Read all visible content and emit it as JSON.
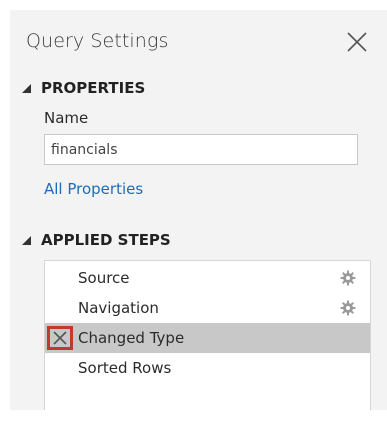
{
  "pane": {
    "title": "Query Settings"
  },
  "properties": {
    "header": "PROPERTIES",
    "name_label": "Name",
    "name_value": "financials",
    "all_properties_link": "All Properties"
  },
  "applied_steps": {
    "header": "APPLIED STEPS",
    "steps": [
      {
        "label": "Source",
        "has_settings": true,
        "selected": false
      },
      {
        "label": "Navigation",
        "has_settings": true,
        "selected": false
      },
      {
        "label": "Changed Type",
        "has_settings": false,
        "selected": true
      },
      {
        "label": "Sorted Rows",
        "has_settings": false,
        "selected": false
      }
    ]
  },
  "colors": {
    "pane_bg": "#f3f3f3",
    "link": "#1e6cb8",
    "selected_row": "#c8c8c8",
    "delete_highlight": "#c0392b"
  },
  "icons": {
    "close": "close-icon",
    "collapse": "collapse-triangle-icon",
    "settings": "gear-icon",
    "delete_step": "delete-step-icon"
  }
}
